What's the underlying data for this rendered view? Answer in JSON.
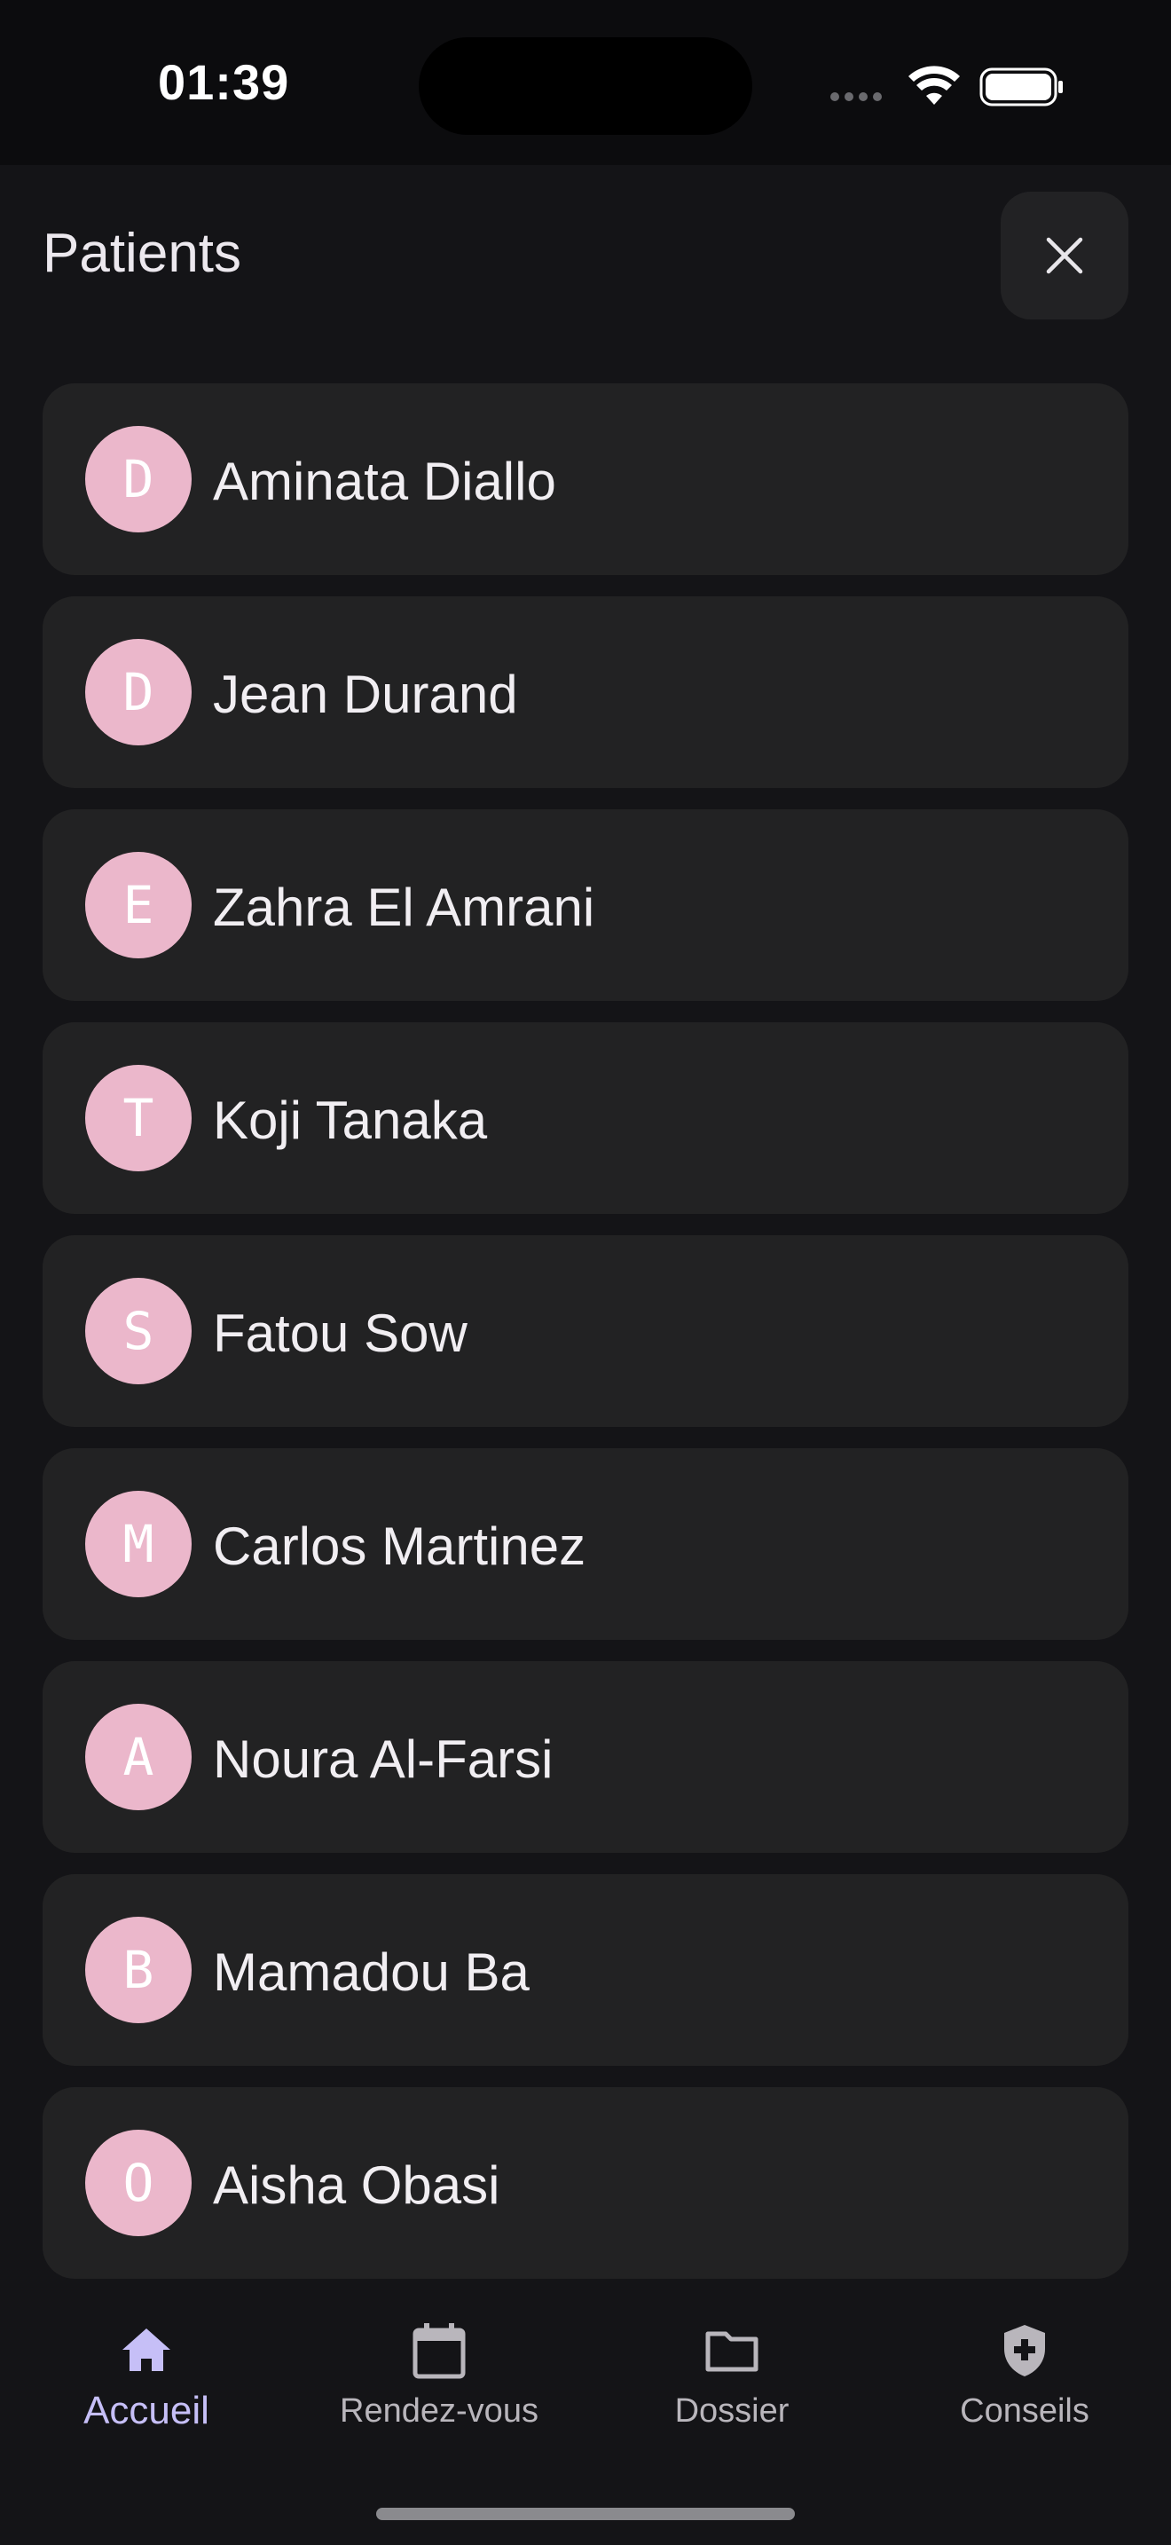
{
  "status_bar": {
    "time": "01:39"
  },
  "header": {
    "title": "Patients"
  },
  "patients": [
    {
      "initial": "D",
      "name": "Aminata Diallo"
    },
    {
      "initial": "D",
      "name": "Jean Durand"
    },
    {
      "initial": "E",
      "name": "Zahra El Amrani"
    },
    {
      "initial": "T",
      "name": "Koji Tanaka"
    },
    {
      "initial": "S",
      "name": "Fatou Sow"
    },
    {
      "initial": "M",
      "name": "Carlos Martinez"
    },
    {
      "initial": "A",
      "name": "Noura Al-Farsi"
    },
    {
      "initial": "B",
      "name": "Mamadou Ba"
    },
    {
      "initial": "O",
      "name": "Aisha Obasi"
    }
  ],
  "bottom_nav": [
    {
      "label": "Accueil",
      "icon": "home-icon",
      "active": true
    },
    {
      "label": "Rendez-vous",
      "icon": "calendar-icon",
      "active": false
    },
    {
      "label": "Dossier",
      "icon": "folder-icon",
      "active": false
    },
    {
      "label": "Conseils",
      "icon": "shield-icon",
      "active": false
    }
  ],
  "colors": {
    "background": "#141417",
    "card": "#222223",
    "avatar": "#ebb7cb",
    "accent": "#c6bff7"
  }
}
